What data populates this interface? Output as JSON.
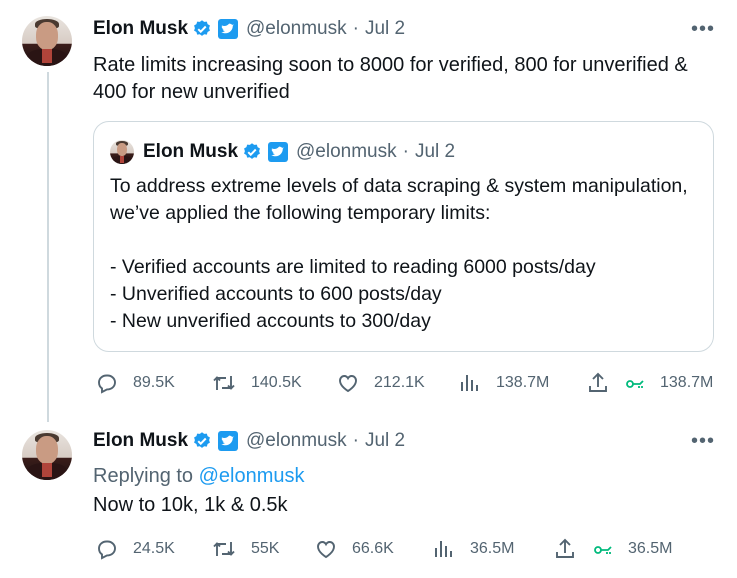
{
  "colors": {
    "accent": "#1d9bf0",
    "muted": "#536471",
    "text": "#0f1419",
    "views_icon": "#00ba7c"
  },
  "tweet1": {
    "author": "Elon Musk",
    "handle": "@elonmusk",
    "sep": "·",
    "date": "Jul 2",
    "text": "Rate limits increasing soon to 8000 for verified, 800 for unverified & 400 for new unverified",
    "quote": {
      "author": "Elon Musk",
      "handle": "@elonmusk",
      "sep": "·",
      "date": "Jul 2",
      "text": "To address extreme levels of data scraping & system manipulation, we’ve applied the following temporary limits:",
      "items": [
        "- Verified accounts are limited to reading 6000 posts/day",
        "- Unverified accounts to 600 posts/day",
        "- New unverified accounts to 300/day"
      ]
    },
    "stats": {
      "replies": "89.5K",
      "reposts": "140.5K",
      "likes": "212.1K",
      "views": "138.7M",
      "views2": "138.7M"
    }
  },
  "tweet2": {
    "author": "Elon Musk",
    "handle": "@elonmusk",
    "sep": "·",
    "date": "Jul 2",
    "replying_prefix": "Replying to ",
    "replying_handle": "@elonmusk",
    "text": "Now to 10k, 1k & 0.5k",
    "stats": {
      "replies": "24.5K",
      "reposts": "55K",
      "likes": "66.6K",
      "views": "36.5M",
      "views2": "36.5M"
    }
  },
  "icons": [
    "verified-badge-icon",
    "affiliate-badge-icon",
    "more-icon",
    "reply-icon",
    "repost-icon",
    "like-icon",
    "views-icon",
    "share-icon",
    "grok-icon"
  ]
}
